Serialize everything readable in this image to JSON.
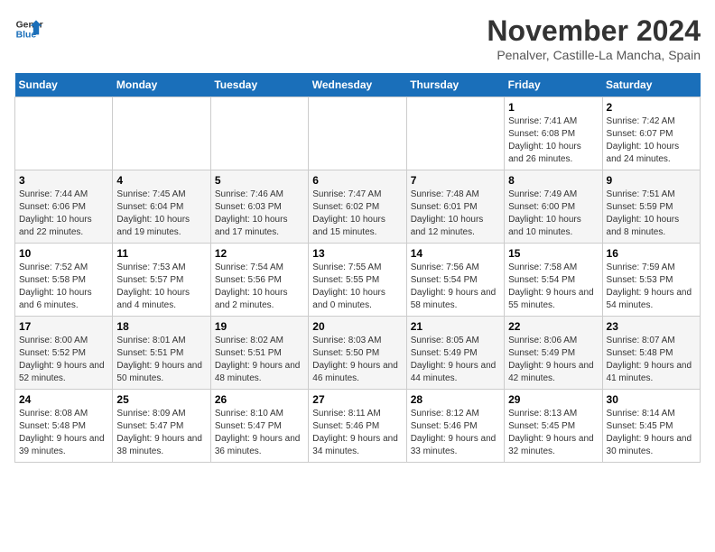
{
  "header": {
    "logo_line1": "General",
    "logo_line2": "Blue",
    "month": "November 2024",
    "location": "Penalver, Castille-La Mancha, Spain"
  },
  "weekdays": [
    "Sunday",
    "Monday",
    "Tuesday",
    "Wednesday",
    "Thursday",
    "Friday",
    "Saturday"
  ],
  "weeks": [
    [
      {
        "day": "",
        "sunrise": "",
        "sunset": "",
        "daylight": ""
      },
      {
        "day": "",
        "sunrise": "",
        "sunset": "",
        "daylight": ""
      },
      {
        "day": "",
        "sunrise": "",
        "sunset": "",
        "daylight": ""
      },
      {
        "day": "",
        "sunrise": "",
        "sunset": "",
        "daylight": ""
      },
      {
        "day": "",
        "sunrise": "",
        "sunset": "",
        "daylight": ""
      },
      {
        "day": "1",
        "sunrise": "Sunrise: 7:41 AM",
        "sunset": "Sunset: 6:08 PM",
        "daylight": "Daylight: 10 hours and 26 minutes."
      },
      {
        "day": "2",
        "sunrise": "Sunrise: 7:42 AM",
        "sunset": "Sunset: 6:07 PM",
        "daylight": "Daylight: 10 hours and 24 minutes."
      }
    ],
    [
      {
        "day": "3",
        "sunrise": "Sunrise: 7:44 AM",
        "sunset": "Sunset: 6:06 PM",
        "daylight": "Daylight: 10 hours and 22 minutes."
      },
      {
        "day": "4",
        "sunrise": "Sunrise: 7:45 AM",
        "sunset": "Sunset: 6:04 PM",
        "daylight": "Daylight: 10 hours and 19 minutes."
      },
      {
        "day": "5",
        "sunrise": "Sunrise: 7:46 AM",
        "sunset": "Sunset: 6:03 PM",
        "daylight": "Daylight: 10 hours and 17 minutes."
      },
      {
        "day": "6",
        "sunrise": "Sunrise: 7:47 AM",
        "sunset": "Sunset: 6:02 PM",
        "daylight": "Daylight: 10 hours and 15 minutes."
      },
      {
        "day": "7",
        "sunrise": "Sunrise: 7:48 AM",
        "sunset": "Sunset: 6:01 PM",
        "daylight": "Daylight: 10 hours and 12 minutes."
      },
      {
        "day": "8",
        "sunrise": "Sunrise: 7:49 AM",
        "sunset": "Sunset: 6:00 PM",
        "daylight": "Daylight: 10 hours and 10 minutes."
      },
      {
        "day": "9",
        "sunrise": "Sunrise: 7:51 AM",
        "sunset": "Sunset: 5:59 PM",
        "daylight": "Daylight: 10 hours and 8 minutes."
      }
    ],
    [
      {
        "day": "10",
        "sunrise": "Sunrise: 7:52 AM",
        "sunset": "Sunset: 5:58 PM",
        "daylight": "Daylight: 10 hours and 6 minutes."
      },
      {
        "day": "11",
        "sunrise": "Sunrise: 7:53 AM",
        "sunset": "Sunset: 5:57 PM",
        "daylight": "Daylight: 10 hours and 4 minutes."
      },
      {
        "day": "12",
        "sunrise": "Sunrise: 7:54 AM",
        "sunset": "Sunset: 5:56 PM",
        "daylight": "Daylight: 10 hours and 2 minutes."
      },
      {
        "day": "13",
        "sunrise": "Sunrise: 7:55 AM",
        "sunset": "Sunset: 5:55 PM",
        "daylight": "Daylight: 10 hours and 0 minutes."
      },
      {
        "day": "14",
        "sunrise": "Sunrise: 7:56 AM",
        "sunset": "Sunset: 5:54 PM",
        "daylight": "Daylight: 9 hours and 58 minutes."
      },
      {
        "day": "15",
        "sunrise": "Sunrise: 7:58 AM",
        "sunset": "Sunset: 5:54 PM",
        "daylight": "Daylight: 9 hours and 55 minutes."
      },
      {
        "day": "16",
        "sunrise": "Sunrise: 7:59 AM",
        "sunset": "Sunset: 5:53 PM",
        "daylight": "Daylight: 9 hours and 54 minutes."
      }
    ],
    [
      {
        "day": "17",
        "sunrise": "Sunrise: 8:00 AM",
        "sunset": "Sunset: 5:52 PM",
        "daylight": "Daylight: 9 hours and 52 minutes."
      },
      {
        "day": "18",
        "sunrise": "Sunrise: 8:01 AM",
        "sunset": "Sunset: 5:51 PM",
        "daylight": "Daylight: 9 hours and 50 minutes."
      },
      {
        "day": "19",
        "sunrise": "Sunrise: 8:02 AM",
        "sunset": "Sunset: 5:51 PM",
        "daylight": "Daylight: 9 hours and 48 minutes."
      },
      {
        "day": "20",
        "sunrise": "Sunrise: 8:03 AM",
        "sunset": "Sunset: 5:50 PM",
        "daylight": "Daylight: 9 hours and 46 minutes."
      },
      {
        "day": "21",
        "sunrise": "Sunrise: 8:05 AM",
        "sunset": "Sunset: 5:49 PM",
        "daylight": "Daylight: 9 hours and 44 minutes."
      },
      {
        "day": "22",
        "sunrise": "Sunrise: 8:06 AM",
        "sunset": "Sunset: 5:49 PM",
        "daylight": "Daylight: 9 hours and 42 minutes."
      },
      {
        "day": "23",
        "sunrise": "Sunrise: 8:07 AM",
        "sunset": "Sunset: 5:48 PM",
        "daylight": "Daylight: 9 hours and 41 minutes."
      }
    ],
    [
      {
        "day": "24",
        "sunrise": "Sunrise: 8:08 AM",
        "sunset": "Sunset: 5:48 PM",
        "daylight": "Daylight: 9 hours and 39 minutes."
      },
      {
        "day": "25",
        "sunrise": "Sunrise: 8:09 AM",
        "sunset": "Sunset: 5:47 PM",
        "daylight": "Daylight: 9 hours and 38 minutes."
      },
      {
        "day": "26",
        "sunrise": "Sunrise: 8:10 AM",
        "sunset": "Sunset: 5:47 PM",
        "daylight": "Daylight: 9 hours and 36 minutes."
      },
      {
        "day": "27",
        "sunrise": "Sunrise: 8:11 AM",
        "sunset": "Sunset: 5:46 PM",
        "daylight": "Daylight: 9 hours and 34 minutes."
      },
      {
        "day": "28",
        "sunrise": "Sunrise: 8:12 AM",
        "sunset": "Sunset: 5:46 PM",
        "daylight": "Daylight: 9 hours and 33 minutes."
      },
      {
        "day": "29",
        "sunrise": "Sunrise: 8:13 AM",
        "sunset": "Sunset: 5:45 PM",
        "daylight": "Daylight: 9 hours and 32 minutes."
      },
      {
        "day": "30",
        "sunrise": "Sunrise: 8:14 AM",
        "sunset": "Sunset: 5:45 PM",
        "daylight": "Daylight: 9 hours and 30 minutes."
      }
    ]
  ]
}
